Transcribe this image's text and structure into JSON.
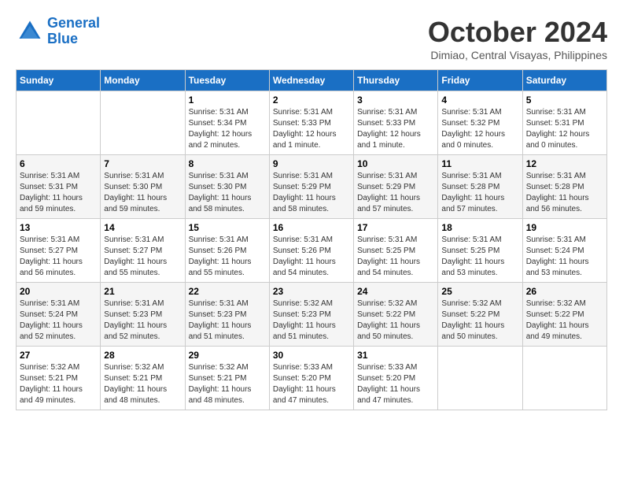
{
  "header": {
    "logo_line1": "General",
    "logo_line2": "Blue",
    "month": "October 2024",
    "location": "Dimiao, Central Visayas, Philippines"
  },
  "weekdays": [
    "Sunday",
    "Monday",
    "Tuesday",
    "Wednesday",
    "Thursday",
    "Friday",
    "Saturday"
  ],
  "weeks": [
    [
      {
        "day": "",
        "info": ""
      },
      {
        "day": "",
        "info": ""
      },
      {
        "day": "1",
        "info": "Sunrise: 5:31 AM\nSunset: 5:34 PM\nDaylight: 12 hours\nand 2 minutes."
      },
      {
        "day": "2",
        "info": "Sunrise: 5:31 AM\nSunset: 5:33 PM\nDaylight: 12 hours\nand 1 minute."
      },
      {
        "day": "3",
        "info": "Sunrise: 5:31 AM\nSunset: 5:33 PM\nDaylight: 12 hours\nand 1 minute."
      },
      {
        "day": "4",
        "info": "Sunrise: 5:31 AM\nSunset: 5:32 PM\nDaylight: 12 hours\nand 0 minutes."
      },
      {
        "day": "5",
        "info": "Sunrise: 5:31 AM\nSunset: 5:31 PM\nDaylight: 12 hours\nand 0 minutes."
      }
    ],
    [
      {
        "day": "6",
        "info": "Sunrise: 5:31 AM\nSunset: 5:31 PM\nDaylight: 11 hours\nand 59 minutes."
      },
      {
        "day": "7",
        "info": "Sunrise: 5:31 AM\nSunset: 5:30 PM\nDaylight: 11 hours\nand 59 minutes."
      },
      {
        "day": "8",
        "info": "Sunrise: 5:31 AM\nSunset: 5:30 PM\nDaylight: 11 hours\nand 58 minutes."
      },
      {
        "day": "9",
        "info": "Sunrise: 5:31 AM\nSunset: 5:29 PM\nDaylight: 11 hours\nand 58 minutes."
      },
      {
        "day": "10",
        "info": "Sunrise: 5:31 AM\nSunset: 5:29 PM\nDaylight: 11 hours\nand 57 minutes."
      },
      {
        "day": "11",
        "info": "Sunrise: 5:31 AM\nSunset: 5:28 PM\nDaylight: 11 hours\nand 57 minutes."
      },
      {
        "day": "12",
        "info": "Sunrise: 5:31 AM\nSunset: 5:28 PM\nDaylight: 11 hours\nand 56 minutes."
      }
    ],
    [
      {
        "day": "13",
        "info": "Sunrise: 5:31 AM\nSunset: 5:27 PM\nDaylight: 11 hours\nand 56 minutes."
      },
      {
        "day": "14",
        "info": "Sunrise: 5:31 AM\nSunset: 5:27 PM\nDaylight: 11 hours\nand 55 minutes."
      },
      {
        "day": "15",
        "info": "Sunrise: 5:31 AM\nSunset: 5:26 PM\nDaylight: 11 hours\nand 55 minutes."
      },
      {
        "day": "16",
        "info": "Sunrise: 5:31 AM\nSunset: 5:26 PM\nDaylight: 11 hours\nand 54 minutes."
      },
      {
        "day": "17",
        "info": "Sunrise: 5:31 AM\nSunset: 5:25 PM\nDaylight: 11 hours\nand 54 minutes."
      },
      {
        "day": "18",
        "info": "Sunrise: 5:31 AM\nSunset: 5:25 PM\nDaylight: 11 hours\nand 53 minutes."
      },
      {
        "day": "19",
        "info": "Sunrise: 5:31 AM\nSunset: 5:24 PM\nDaylight: 11 hours\nand 53 minutes."
      }
    ],
    [
      {
        "day": "20",
        "info": "Sunrise: 5:31 AM\nSunset: 5:24 PM\nDaylight: 11 hours\nand 52 minutes."
      },
      {
        "day": "21",
        "info": "Sunrise: 5:31 AM\nSunset: 5:23 PM\nDaylight: 11 hours\nand 52 minutes."
      },
      {
        "day": "22",
        "info": "Sunrise: 5:31 AM\nSunset: 5:23 PM\nDaylight: 11 hours\nand 51 minutes."
      },
      {
        "day": "23",
        "info": "Sunrise: 5:32 AM\nSunset: 5:23 PM\nDaylight: 11 hours\nand 51 minutes."
      },
      {
        "day": "24",
        "info": "Sunrise: 5:32 AM\nSunset: 5:22 PM\nDaylight: 11 hours\nand 50 minutes."
      },
      {
        "day": "25",
        "info": "Sunrise: 5:32 AM\nSunset: 5:22 PM\nDaylight: 11 hours\nand 50 minutes."
      },
      {
        "day": "26",
        "info": "Sunrise: 5:32 AM\nSunset: 5:22 PM\nDaylight: 11 hours\nand 49 minutes."
      }
    ],
    [
      {
        "day": "27",
        "info": "Sunrise: 5:32 AM\nSunset: 5:21 PM\nDaylight: 11 hours\nand 49 minutes."
      },
      {
        "day": "28",
        "info": "Sunrise: 5:32 AM\nSunset: 5:21 PM\nDaylight: 11 hours\nand 48 minutes."
      },
      {
        "day": "29",
        "info": "Sunrise: 5:32 AM\nSunset: 5:21 PM\nDaylight: 11 hours\nand 48 minutes."
      },
      {
        "day": "30",
        "info": "Sunrise: 5:33 AM\nSunset: 5:20 PM\nDaylight: 11 hours\nand 47 minutes."
      },
      {
        "day": "31",
        "info": "Sunrise: 5:33 AM\nSunset: 5:20 PM\nDaylight: 11 hours\nand 47 minutes."
      },
      {
        "day": "",
        "info": ""
      },
      {
        "day": "",
        "info": ""
      }
    ]
  ]
}
